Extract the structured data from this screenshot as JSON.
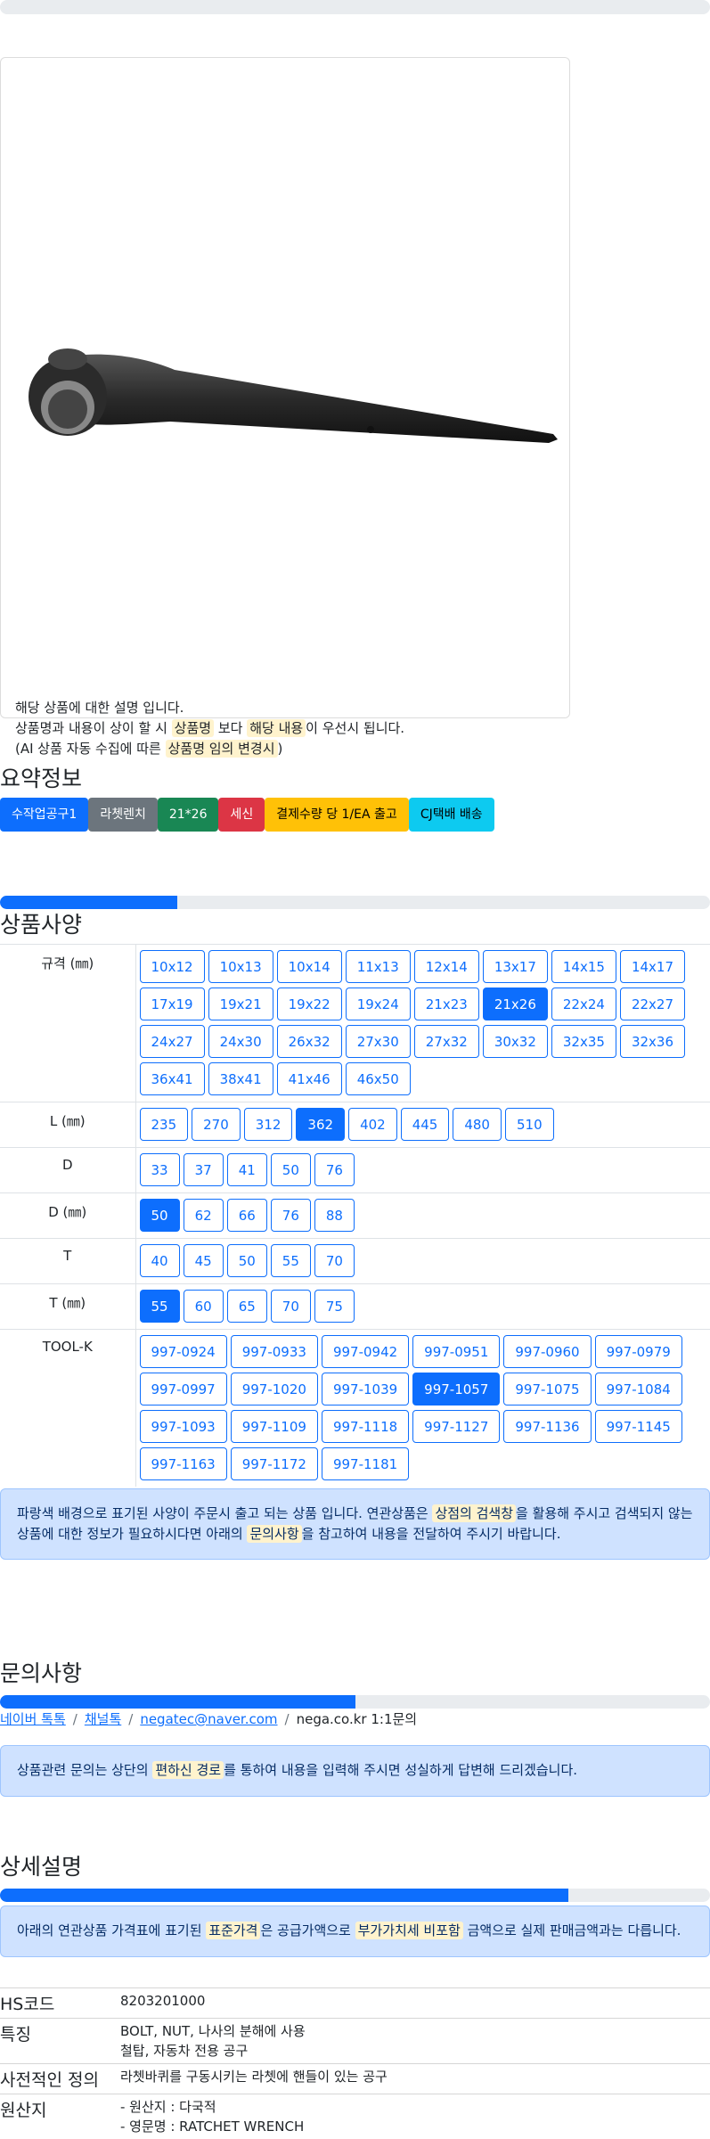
{
  "product_card": {
    "image_alt": "라쳇렌치 21*26 세신 product image",
    "desc_line1": "해당 상품에 대한 설명 입니다.",
    "desc_line2_pre": "상품명과 내용이 상이 할 시 ",
    "desc_line2_hl1": "상품명",
    "desc_line2_mid": " 보다 ",
    "desc_line2_hl2": "해당 내용",
    "desc_line2_post": "이 우선시 됩니다.",
    "desc_line3_pre": "(AI 상품 자동 수집에 따른 ",
    "desc_line3_hl": "상품명 임의 변경시",
    "desc_line3_post": ")"
  },
  "summary": {
    "title": "요약정보",
    "badges": [
      {
        "label": "수작업공구1",
        "color": "#0d6efd"
      },
      {
        "label": "라쳇렌치",
        "color": "#6c757d"
      },
      {
        "label": "21*26",
        "color": "#198754"
      },
      {
        "label": "세신",
        "color": "#dc3545"
      },
      {
        "label": "결제수량 당 1/EA 출고",
        "color": "#ffc107"
      },
      {
        "label": "CJ택배 배송",
        "color": "#0dcaf0"
      }
    ]
  },
  "specs": {
    "title": "상품사양",
    "progress": 0.25,
    "rows": [
      {
        "label": "규격 (㎜)",
        "options": [
          "10x12",
          "10x13",
          "10x14",
          "11x13",
          "12x14",
          "13x17",
          "14x15",
          "14x17",
          "17x19",
          "19x21",
          "19x22",
          "19x24",
          "21x23",
          "21x26",
          "22x24",
          "22x27",
          "24x27",
          "24x30",
          "26x32",
          "27x30",
          "27x32",
          "30x32",
          "32x35",
          "32x36",
          "36x41",
          "38x41",
          "41x46",
          "46x50"
        ],
        "selected": "21x26"
      },
      {
        "label": "L (㎜)",
        "options": [
          "235",
          "270",
          "312",
          "362",
          "402",
          "445",
          "480",
          "510"
        ],
        "selected": "362"
      },
      {
        "label": "D",
        "options": [
          "33",
          "37",
          "41",
          "50",
          "76"
        ],
        "selected": ""
      },
      {
        "label": "D (㎜)",
        "options": [
          "50",
          "62",
          "66",
          "76",
          "88"
        ],
        "selected": "50"
      },
      {
        "label": "T",
        "options": [
          "40",
          "45",
          "50",
          "55",
          "70"
        ],
        "selected": ""
      },
      {
        "label": "T (㎜)",
        "options": [
          "55",
          "60",
          "65",
          "70",
          "75"
        ],
        "selected": "55"
      },
      {
        "label": "TOOL-K",
        "options": [
          "997-0924",
          "997-0933",
          "997-0942",
          "997-0951",
          "997-0960",
          "997-0979",
          "997-0997",
          "997-1020",
          "997-1039",
          "997-1057",
          "997-1075",
          "997-1084",
          "997-1093",
          "997-1109",
          "997-1118",
          "997-1127",
          "997-1136",
          "997-1145",
          "997-1163",
          "997-1172",
          "997-1181"
        ],
        "selected": "997-1057"
      }
    ],
    "notice_pre": "파랑색 배경으로 표기된 사양이 주문시 출고 되는 상품 입니다. 연관상품은 ",
    "notice_hl1": "상점의 검색창",
    "notice_mid": "을 활용해 주시고 검색되지 않는 상품에 대한 정보가 필요하시다면 아래의 ",
    "notice_hl2": "문의사항",
    "notice_post": "을 참고하여 내용을 전달하여 주시기 바랍니다."
  },
  "inquiry": {
    "title": "문의사항",
    "progress": 0.5,
    "link1": "네이버 톡톡",
    "link2": "채널톡",
    "link3": "negatec@naver.com",
    "text4": "nega.co.kr 1:1문의",
    "notice_pre": "상품관련 문의는 상단의 ",
    "notice_hl": "편하신 경로",
    "notice_post": "를 통하여 내용을 입력해 주시면 성실하게 답변해 드리겠습니다."
  },
  "detail": {
    "title": "상세설명",
    "progress": 0.8,
    "notice_pre": "아래의 연관상품 가격표에 표기된 ",
    "notice_hl1": "표준가격",
    "notice_mid": "은 공급가액으로 ",
    "notice_hl2": "부가가치세 비포함",
    "notice_post": " 금액으로 실제 판매금액과는 다릅니다.",
    "info": [
      {
        "key": "HS코드",
        "lines": [
          "8203201000"
        ]
      },
      {
        "key": "특징",
        "lines": [
          "BOLT, NUT, 나사의 분해에 사용",
          "철탑, 자동차 전용 공구"
        ]
      },
      {
        "key": "사전적인 정의",
        "lines": [
          "라쳇바퀴를 구동시키는 라쳇에 핸들이 있는 공구"
        ]
      },
      {
        "key": "원산지",
        "lines": [
          "- 원산지 : 다국적",
          "- 영문명 : RATCHET WRENCH"
        ]
      }
    ]
  }
}
